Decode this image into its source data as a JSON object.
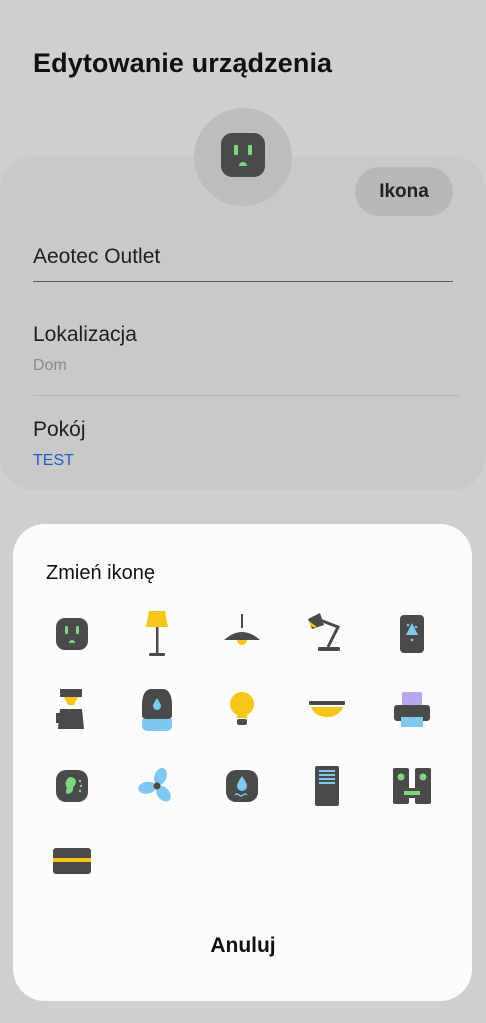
{
  "header": {
    "title": "Edytowanie urządzenia"
  },
  "device": {
    "icon": "outlet-icon",
    "icon_button_label": "Ikona",
    "name_value": "Aeotec Outlet"
  },
  "location": {
    "label": "Lokalizacja",
    "value": "Dom"
  },
  "room": {
    "label": "Pokój",
    "value": "TEST"
  },
  "icon_picker": {
    "title": "Zmień ikonę",
    "icons": [
      "outlet-icon",
      "floor-lamp-icon",
      "ceiling-pendant-lamp-icon",
      "desk-lamp-icon",
      "air-purifier-icon",
      "coffee-maker-icon",
      "humidifier-icon",
      "light-bulb-icon",
      "ceiling-light-icon",
      "printer-icon",
      "hearing-sensor-icon",
      "fan-icon",
      "water-leak-sensor-icon",
      "tower-server-icon",
      "speaker-system-icon",
      "card-reader-icon"
    ],
    "cancel_label": "Anuluj"
  },
  "colors": {
    "background": "#cfcfcf",
    "sheet": "#fcfcfc",
    "icon_dark": "#4a4a4a",
    "accent_green": "#7dd87d",
    "accent_yellow": "#f5c518",
    "accent_blue": "#7fc9f0",
    "accent_purple": "#b8a6ee",
    "link_blue": "#1f5ec9"
  }
}
